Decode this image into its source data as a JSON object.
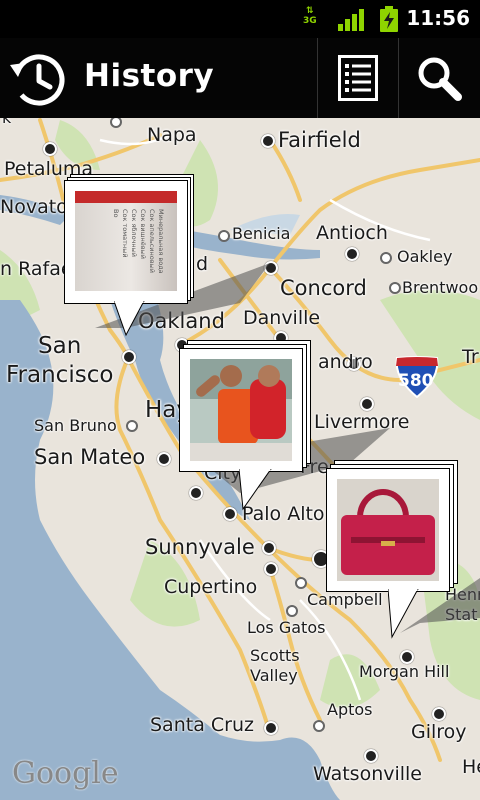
{
  "status_bar": {
    "network": "3G",
    "time": "11:56",
    "colors": {
      "signal": "#8fd400"
    }
  },
  "action_bar": {
    "title": "History",
    "icons": [
      "history-clock-icon",
      "list-view-icon",
      "search-icon"
    ]
  },
  "map": {
    "attribution": "Google",
    "shield": "580",
    "cities": {
      "napa": "Napa",
      "fairfield": "Fairfield",
      "petaluma": "Petaluma",
      "novato": "Novato",
      "rafael": "n Rafael",
      "benicia": "Benicia",
      "antioch": "Antioch",
      "oakley": "Oakley",
      "concord": "Concord",
      "brentwood": "Brentwoo",
      "oakland": "Oakland",
      "danville": "Danville",
      "san": "San",
      "francisco": "Francisco",
      "ramon": "andro",
      "tr": "Tr",
      "hay": "Hay",
      "livermore": "Livermore",
      "san_bruno": "San Bruno",
      "san_mateo": "San Mateo",
      "city": "City",
      "fre": "Fre",
      "palo_alto": "Palo Alto",
      "sunnyvale": "Sunnyvale",
      "cupertino": "Cupertino",
      "campbell": "Campbell",
      "henry": "Henry",
      "stat": "Stat",
      "los_gatos": "Los Gatos",
      "scotts": "Scotts",
      "valley": "Valley",
      "morgan_hill": "Morgan Hill",
      "aptos": "Aptos",
      "santa_cruz": "Santa Cruz",
      "gilroy": "Gilroy",
      "watsonville": "Watsonville",
      "he": "He",
      "top_left": "k",
      "d": "d"
    },
    "photo_markers": [
      {
        "subject": "juice carton label",
        "text_lines": [
          "Минеральная вода",
          "Сок апельсиновый",
          "Сок вишнёвый",
          "Сок яблочный",
          "Сок томатный",
          "Во"
        ]
      },
      {
        "subject": "child flexing on shoulders"
      },
      {
        "subject": "red handbag"
      }
    ]
  }
}
